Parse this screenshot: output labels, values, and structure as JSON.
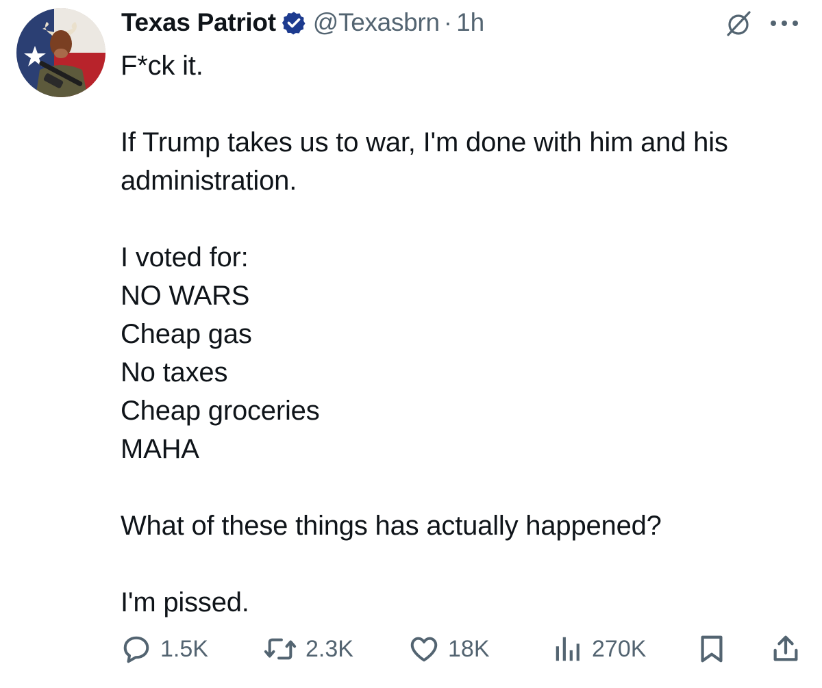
{
  "author": {
    "display_name": "Texas Patriot",
    "handle": "@Texasbrn",
    "separator": "·",
    "time": "1h",
    "verified_icon": "verified-badge-icon"
  },
  "tweet": {
    "lines": [
      "F*ck it.",
      "",
      "If Trump takes us to war, I'm done with him and his",
      "administration.",
      "",
      "I voted for:",
      "NO WARS",
      "Cheap gas",
      "No taxes",
      "Cheap groceries",
      "MAHA",
      "",
      "What of these things has actually happened?",
      "",
      "I'm pissed."
    ]
  },
  "actions": {
    "replies": "1.5K",
    "reposts": "2.3K",
    "likes": "18K",
    "views": "270K"
  },
  "colors": {
    "text": "#0f1419",
    "secondary": "#536471",
    "verified": "#1d3b8f"
  }
}
